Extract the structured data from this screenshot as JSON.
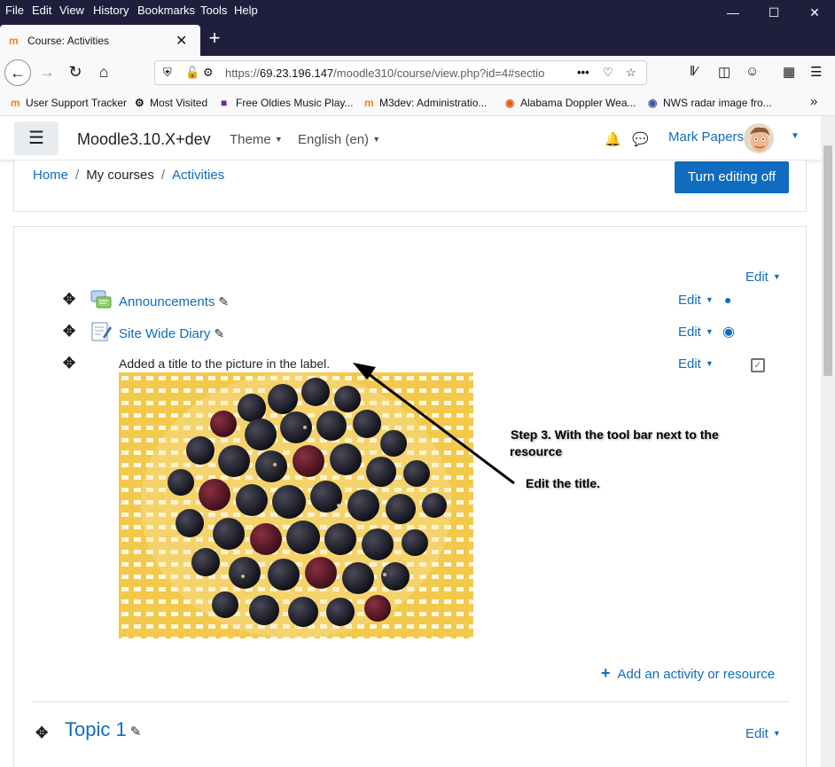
{
  "browser": {
    "menu": [
      "File",
      "Edit",
      "View",
      "History",
      "Bookmarks",
      "Tools",
      "Help"
    ],
    "tab_title": "Course: Activities",
    "url_prefix": "https://",
    "url_host": "69.23.196.147",
    "url_path": "/moodle310/course/view.php?id=4#sectio",
    "bookmarks": [
      {
        "label": "User Support Tracker",
        "icon": "moodle-icon"
      },
      {
        "label": "Most Visited",
        "icon": "gear-icon"
      },
      {
        "label": "Free Oldies Music Play...",
        "icon": "radio-icon"
      },
      {
        "label": "M3dev: Administratio...",
        "icon": "moodle-icon"
      },
      {
        "label": "Alabama Doppler Wea...",
        "icon": "weather-icon"
      },
      {
        "label": "NWS radar image fro...",
        "icon": "nws-icon"
      }
    ]
  },
  "moodle": {
    "site_name": "Moodle3.10.X+dev",
    "theme_label": "Theme",
    "language_label": "English (en)",
    "user_name": "Mark Papers",
    "breadcrumb": {
      "home": "Home",
      "my_courses": "My courses",
      "current": "Activities"
    },
    "editing_button": "Turn editing off",
    "section_edit": "Edit",
    "activities": [
      {
        "name": "Announcements",
        "edit": "Edit",
        "icon": "forum-icon",
        "availability": "user-icon"
      },
      {
        "name": "Site Wide Diary",
        "edit": "Edit",
        "icon": "diary-icon",
        "availability": "user-circle-icon"
      },
      {
        "name": "Added a title to the picture in the label.",
        "edit": "Edit",
        "icon": "label",
        "availability": "checkbox-icon"
      }
    ],
    "add_activity": "Add an activity or resource",
    "topic1_title": "Topic 1",
    "topic1_edit": "Edit"
  },
  "annotation": {
    "line1": "Step 3. With the tool bar next to the",
    "line2": "resource",
    "line3": "Edit the title."
  },
  "colors": {
    "link": "#0f6cbf",
    "browser_dark": "#1f1f3d",
    "primary_button": "#0f6cbf"
  }
}
